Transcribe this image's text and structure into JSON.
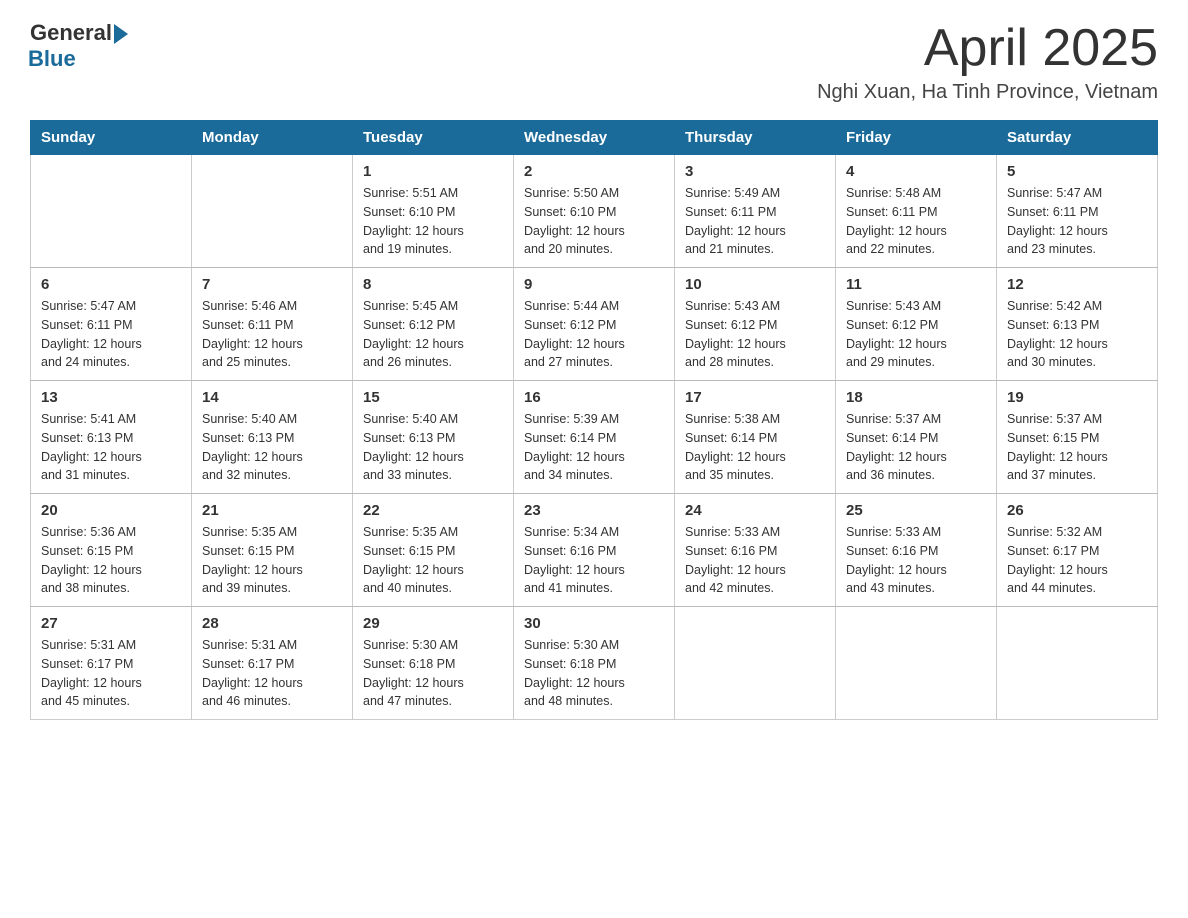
{
  "logo": {
    "text_general": "General",
    "text_blue": "Blue"
  },
  "title": "April 2025",
  "location": "Nghi Xuan, Ha Tinh Province, Vietnam",
  "weekdays": [
    "Sunday",
    "Monday",
    "Tuesday",
    "Wednesday",
    "Thursday",
    "Friday",
    "Saturday"
  ],
  "weeks": [
    [
      {
        "day": "",
        "info": ""
      },
      {
        "day": "",
        "info": ""
      },
      {
        "day": "1",
        "info": "Sunrise: 5:51 AM\nSunset: 6:10 PM\nDaylight: 12 hours\nand 19 minutes."
      },
      {
        "day": "2",
        "info": "Sunrise: 5:50 AM\nSunset: 6:10 PM\nDaylight: 12 hours\nand 20 minutes."
      },
      {
        "day": "3",
        "info": "Sunrise: 5:49 AM\nSunset: 6:11 PM\nDaylight: 12 hours\nand 21 minutes."
      },
      {
        "day": "4",
        "info": "Sunrise: 5:48 AM\nSunset: 6:11 PM\nDaylight: 12 hours\nand 22 minutes."
      },
      {
        "day": "5",
        "info": "Sunrise: 5:47 AM\nSunset: 6:11 PM\nDaylight: 12 hours\nand 23 minutes."
      }
    ],
    [
      {
        "day": "6",
        "info": "Sunrise: 5:47 AM\nSunset: 6:11 PM\nDaylight: 12 hours\nand 24 minutes."
      },
      {
        "day": "7",
        "info": "Sunrise: 5:46 AM\nSunset: 6:11 PM\nDaylight: 12 hours\nand 25 minutes."
      },
      {
        "day": "8",
        "info": "Sunrise: 5:45 AM\nSunset: 6:12 PM\nDaylight: 12 hours\nand 26 minutes."
      },
      {
        "day": "9",
        "info": "Sunrise: 5:44 AM\nSunset: 6:12 PM\nDaylight: 12 hours\nand 27 minutes."
      },
      {
        "day": "10",
        "info": "Sunrise: 5:43 AM\nSunset: 6:12 PM\nDaylight: 12 hours\nand 28 minutes."
      },
      {
        "day": "11",
        "info": "Sunrise: 5:43 AM\nSunset: 6:12 PM\nDaylight: 12 hours\nand 29 minutes."
      },
      {
        "day": "12",
        "info": "Sunrise: 5:42 AM\nSunset: 6:13 PM\nDaylight: 12 hours\nand 30 minutes."
      }
    ],
    [
      {
        "day": "13",
        "info": "Sunrise: 5:41 AM\nSunset: 6:13 PM\nDaylight: 12 hours\nand 31 minutes."
      },
      {
        "day": "14",
        "info": "Sunrise: 5:40 AM\nSunset: 6:13 PM\nDaylight: 12 hours\nand 32 minutes."
      },
      {
        "day": "15",
        "info": "Sunrise: 5:40 AM\nSunset: 6:13 PM\nDaylight: 12 hours\nand 33 minutes."
      },
      {
        "day": "16",
        "info": "Sunrise: 5:39 AM\nSunset: 6:14 PM\nDaylight: 12 hours\nand 34 minutes."
      },
      {
        "day": "17",
        "info": "Sunrise: 5:38 AM\nSunset: 6:14 PM\nDaylight: 12 hours\nand 35 minutes."
      },
      {
        "day": "18",
        "info": "Sunrise: 5:37 AM\nSunset: 6:14 PM\nDaylight: 12 hours\nand 36 minutes."
      },
      {
        "day": "19",
        "info": "Sunrise: 5:37 AM\nSunset: 6:15 PM\nDaylight: 12 hours\nand 37 minutes."
      }
    ],
    [
      {
        "day": "20",
        "info": "Sunrise: 5:36 AM\nSunset: 6:15 PM\nDaylight: 12 hours\nand 38 minutes."
      },
      {
        "day": "21",
        "info": "Sunrise: 5:35 AM\nSunset: 6:15 PM\nDaylight: 12 hours\nand 39 minutes."
      },
      {
        "day": "22",
        "info": "Sunrise: 5:35 AM\nSunset: 6:15 PM\nDaylight: 12 hours\nand 40 minutes."
      },
      {
        "day": "23",
        "info": "Sunrise: 5:34 AM\nSunset: 6:16 PM\nDaylight: 12 hours\nand 41 minutes."
      },
      {
        "day": "24",
        "info": "Sunrise: 5:33 AM\nSunset: 6:16 PM\nDaylight: 12 hours\nand 42 minutes."
      },
      {
        "day": "25",
        "info": "Sunrise: 5:33 AM\nSunset: 6:16 PM\nDaylight: 12 hours\nand 43 minutes."
      },
      {
        "day": "26",
        "info": "Sunrise: 5:32 AM\nSunset: 6:17 PM\nDaylight: 12 hours\nand 44 minutes."
      }
    ],
    [
      {
        "day": "27",
        "info": "Sunrise: 5:31 AM\nSunset: 6:17 PM\nDaylight: 12 hours\nand 45 minutes."
      },
      {
        "day": "28",
        "info": "Sunrise: 5:31 AM\nSunset: 6:17 PM\nDaylight: 12 hours\nand 46 minutes."
      },
      {
        "day": "29",
        "info": "Sunrise: 5:30 AM\nSunset: 6:18 PM\nDaylight: 12 hours\nand 47 minutes."
      },
      {
        "day": "30",
        "info": "Sunrise: 5:30 AM\nSunset: 6:18 PM\nDaylight: 12 hours\nand 48 minutes."
      },
      {
        "day": "",
        "info": ""
      },
      {
        "day": "",
        "info": ""
      },
      {
        "day": "",
        "info": ""
      }
    ]
  ]
}
